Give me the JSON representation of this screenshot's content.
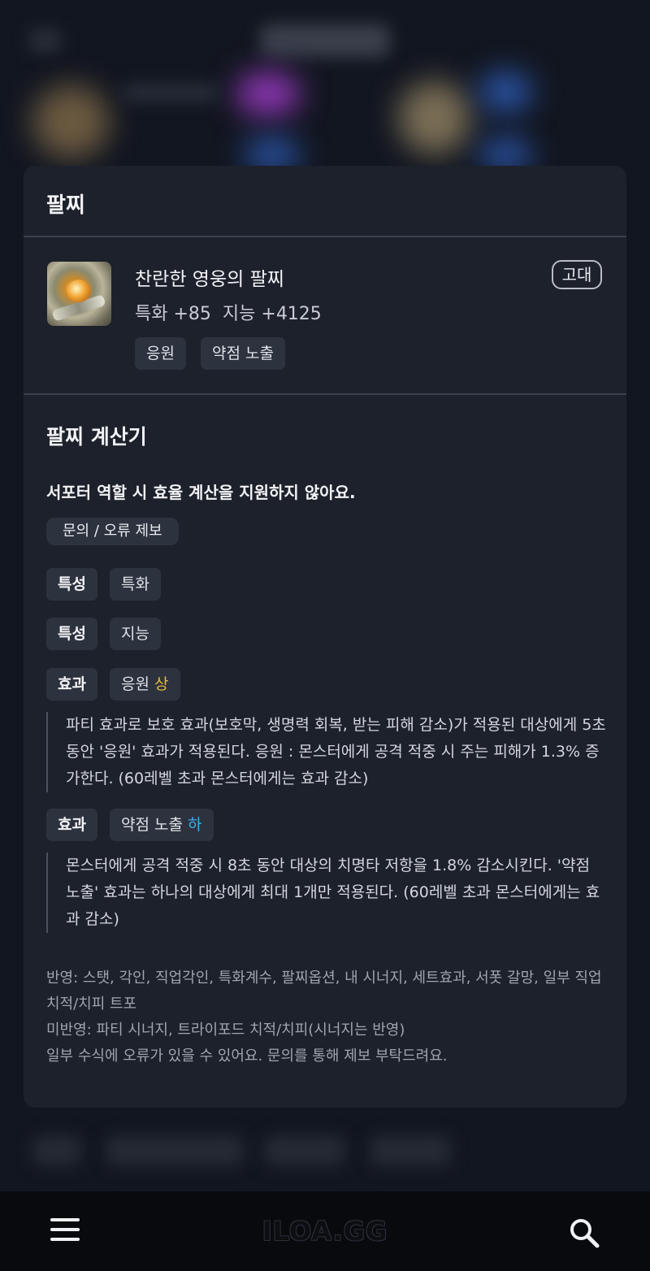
{
  "card": {
    "title": "팔찌",
    "item": {
      "name": "찬란한 영웅의 팔찌",
      "stats": [
        "특화 +85",
        "지능 +4125"
      ],
      "grade": "고대",
      "tags": [
        "응원",
        "약점 노출"
      ]
    },
    "calculator": {
      "title": "팔찌 계산기",
      "notice": "서포터 역할 시 효율 계산을 지원하지 않아요.",
      "report_button": "문의 / 오류 제보",
      "rows": [
        {
          "label": "특성",
          "value": "특화"
        },
        {
          "label": "특성",
          "value": "지능"
        },
        {
          "label": "효과",
          "value": "응원",
          "grade": "상",
          "description": "파티 효과로 보호 효과(보호막, 생명력 회복, 받는 피해 감소)가 적용된 대상에게 5초 동안 '응원' 효과가 적용된다. 응원 : 몬스터에게 공격 적중 시 주는 피해가 1.3% 증가한다. (60레벨 초과 몬스터에게는 효과 감소)"
        },
        {
          "label": "효과",
          "value": "약점 노출",
          "grade": "하",
          "description": "몬스터에게 공격 적중 시 8초 동안 대상의 치명타 저항을 1.8% 감소시킨다. '약점 노출' 효과는 하나의 대상에게 최대 1개만 적용된다. (60레벨 초과 몬스터에게는 효과 감소)"
        }
      ],
      "footer": [
        "반영: 스탯, 각인, 직업각인, 특화계수, 팔찌옵션, 내 시너지, 세트효과, 서폿 갈망, 일부 직업 치적/치피 트포",
        "미반영: 파티 시너지, 트라이포드 치적/치피(시너지는 반영)",
        "일부 수식에 오류가 있을 수 있어요. 문의를 통해 제보 부탁드려요."
      ]
    }
  },
  "bottom_bar": {
    "logo": "ILOA.GG",
    "menu_icon": "hamburger-menu-icon",
    "search_icon": "search-icon"
  },
  "colors": {
    "grade_high": "#e6b93a",
    "grade_low": "#38b2ea",
    "card_bg": "#1d212b"
  }
}
